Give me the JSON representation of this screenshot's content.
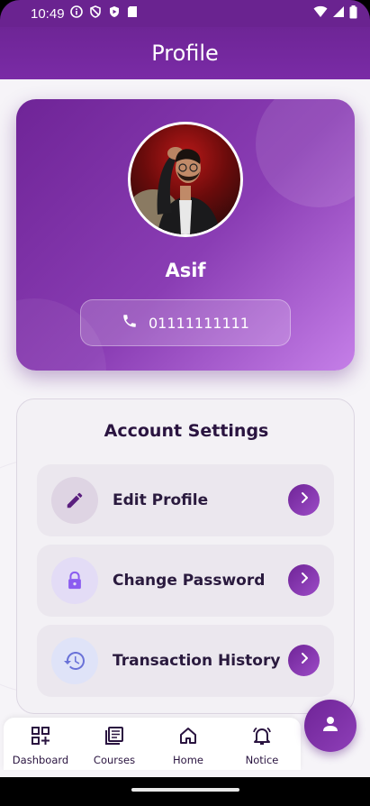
{
  "status_bar": {
    "time": "10:49",
    "icons": [
      "info-icon",
      "shield-icon",
      "play-protect-icon",
      "sd-card-icon",
      "wifi-icon",
      "signal-icon",
      "battery-icon"
    ]
  },
  "app_bar": {
    "title": "Profile"
  },
  "profile": {
    "name": "Asif",
    "phone": "01111111111"
  },
  "account_settings": {
    "title": "Account Settings",
    "items": [
      {
        "label": "Edit Profile",
        "icon": "edit-pencil-icon"
      },
      {
        "label": "Change Password",
        "icon": "lock-icon"
      },
      {
        "label": "Transaction History",
        "icon": "history-icon"
      }
    ]
  },
  "bottom_nav": {
    "items": [
      {
        "label": "Dashboard",
        "icon": "dashboard-icon"
      },
      {
        "label": "Courses",
        "icon": "courses-icon"
      },
      {
        "label": "Home",
        "icon": "home-icon"
      },
      {
        "label": "Notice",
        "icon": "bell-icon"
      }
    ],
    "fab_icon": "person-icon"
  },
  "colors": {
    "primary": "#6f2497",
    "accent": "#9c4bc6",
    "text_dark": "#2a1440"
  }
}
